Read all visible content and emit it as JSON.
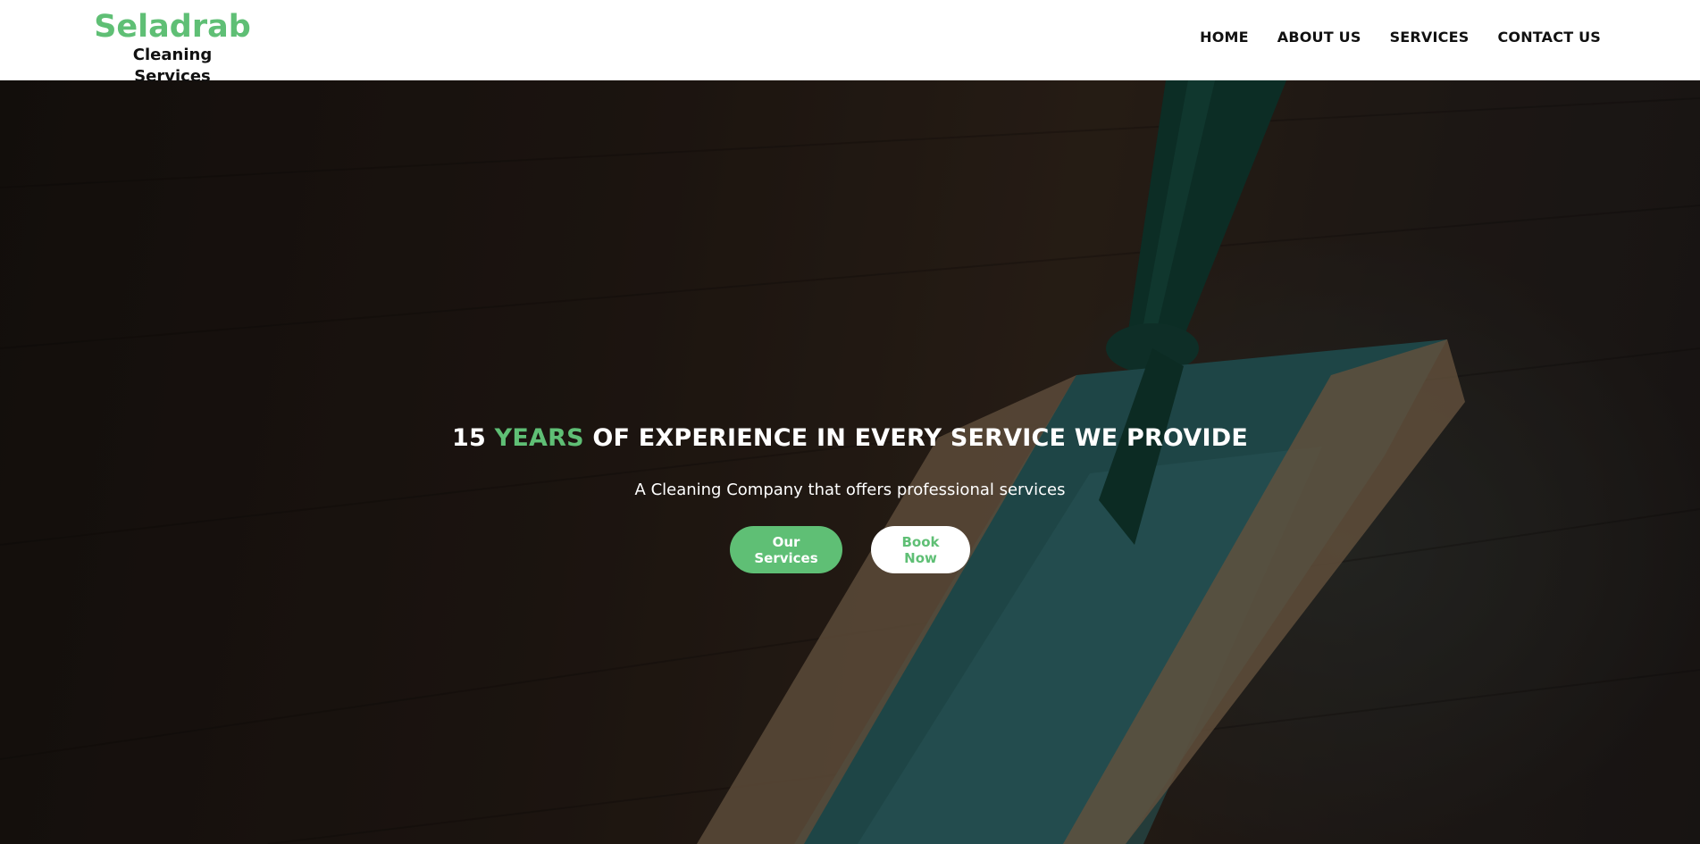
{
  "brand": {
    "name": "Seladrab",
    "subtitle": "Cleaning Services"
  },
  "nav": {
    "items": [
      "HOME",
      "ABOUT US",
      "SERVICES",
      "CONTACT US"
    ]
  },
  "hero": {
    "title_prefix": "15 ",
    "title_accent": "YEARS",
    "title_suffix": " OF EXPERIENCE IN EVERY SERVICE WE PROVIDE",
    "subtitle": "A Cleaning Company that offers professional services",
    "buttons": {
      "primary": "Our Services",
      "secondary": "Book Now"
    }
  },
  "colors": {
    "accent": "#5fbf75",
    "header_bg": "#ffffff",
    "text_dark": "#111111"
  }
}
